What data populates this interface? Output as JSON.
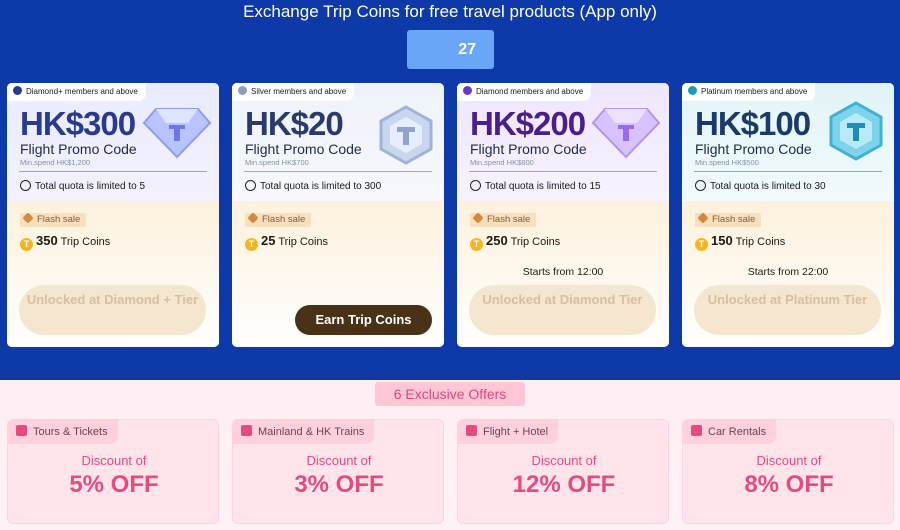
{
  "header": {
    "title": "Exchange Trip Coins for free travel products (App only)",
    "coin_balance": "27"
  },
  "cards": [
    {
      "tier": "Diamond+ members and above",
      "amount": "HK$300",
      "product": "Flight Promo Code",
      "min_spend": "Min.spend HK$1,200",
      "quota": "Total quota is limited to 5",
      "flash": "Flash sale",
      "coins": "350",
      "coins_unit": "Trip Coins",
      "starts": "",
      "button": "Unlocked at Diamond + Tier",
      "button_type": "locked",
      "accent": "#2a3a8c",
      "gem": "diamond-icon"
    },
    {
      "tier": "Silver members and above",
      "amount": "HK$20",
      "product": "Flight Promo Code",
      "min_spend": "Min.spend HK$700",
      "quota": "Total quota is limited to 300",
      "flash": "Flash sale",
      "coins": "25",
      "coins_unit": "Trip Coins",
      "starts": "",
      "button": "Earn Trip Coins",
      "button_type": "earn",
      "accent": "#2a3a6c",
      "gem": "silver-hexagon-icon"
    },
    {
      "tier": "Diamond members and above",
      "amount": "HK$200",
      "product": "Flight Promo Code",
      "min_spend": "Min.spend HK$800",
      "quota": "Total quota is limited to 15",
      "flash": "Flash sale",
      "coins": "250",
      "coins_unit": "Trip Coins",
      "starts": "Starts from 12:00",
      "button": "Unlocked at Diamond Tier",
      "button_type": "locked",
      "accent": "#4a1e8c",
      "gem": "diamond-icon"
    },
    {
      "tier": "Platinum members and above",
      "amount": "HK$100",
      "product": "Flight Promo Code",
      "min_spend": "Min.spend HK$500",
      "quota": "Total quota is limited to 30",
      "flash": "Flash sale",
      "coins": "150",
      "coins_unit": "Trip Coins",
      "starts": "Starts from 22:00",
      "button": "Unlocked at Platinum Tier",
      "button_type": "locked",
      "accent": "#1a3a6c",
      "gem": "platinum-hexagon-icon"
    }
  ],
  "offers_section": {
    "title": "6 Exclusive Offers",
    "offers": [
      {
        "category": "Tours & Tickets",
        "label": "Discount of",
        "value": "5% OFF"
      },
      {
        "category": "Mainland & HK Trains",
        "label": "Discount of",
        "value": "3% OFF"
      },
      {
        "category": "Flight + Hotel",
        "label": "Discount of",
        "value": "12% OFF"
      },
      {
        "category": "Car Rentals",
        "label": "Discount of",
        "value": "8% OFF"
      }
    ]
  },
  "colors": {
    "background": "#0d3aa8",
    "offer_accent": "#e64a7e",
    "coin": "#f6b51e"
  }
}
